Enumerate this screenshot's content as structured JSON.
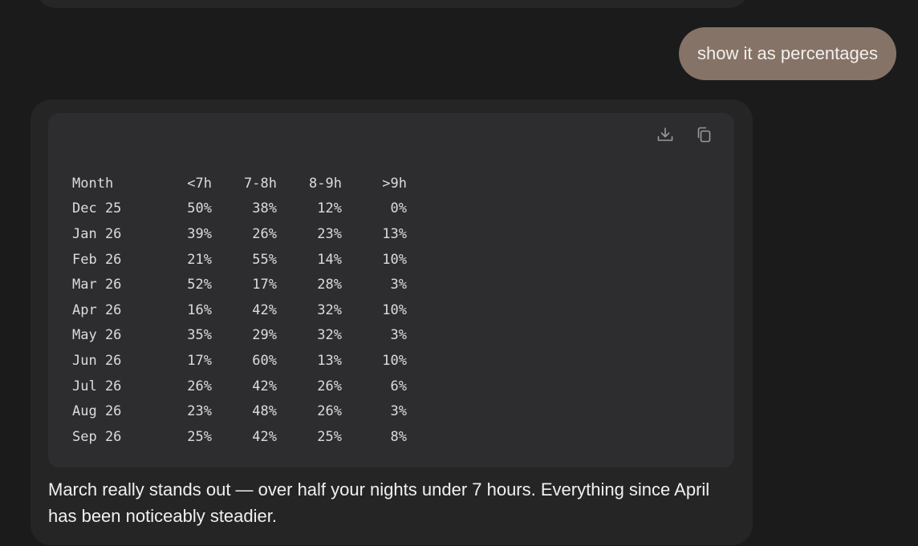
{
  "conversation": {
    "user_message": "show it as percentages",
    "assistant": {
      "code_block": {
        "actions": {
          "download_icon": "download-icon",
          "copy_icon": "copy-icon"
        },
        "columns": [
          "Month",
          "<7h",
          "7-8h",
          "8-9h",
          ">9h"
        ],
        "rows": [
          [
            "Dec 25",
            "50%",
            "38%",
            "12%",
            "0%"
          ],
          [
            "Jan 26",
            "39%",
            "26%",
            "23%",
            "13%"
          ],
          [
            "Feb 26",
            "21%",
            "55%",
            "14%",
            "10%"
          ],
          [
            "Mar 26",
            "52%",
            "17%",
            "28%",
            "3%"
          ],
          [
            "Apr 26",
            "16%",
            "42%",
            "32%",
            "10%"
          ],
          [
            "May 26",
            "35%",
            "29%",
            "32%",
            "3%"
          ],
          [
            "Jun 26",
            "17%",
            "60%",
            "13%",
            "10%"
          ],
          [
            "Jul 26",
            "26%",
            "42%",
            "26%",
            "6%"
          ],
          [
            "Aug 26",
            "23%",
            "48%",
            "26%",
            "3%"
          ],
          [
            "Sep 26",
            "25%",
            "42%",
            "25%",
            "8%"
          ]
        ]
      },
      "text": "March really stands out — over half your nights under 7 hours. Everything since April has been noticeably steadier."
    }
  },
  "colors": {
    "background": "#1b1b1b",
    "user_bubble": "#857367",
    "assistant_bubble": "#252525",
    "code_block": "#2d2d30"
  }
}
